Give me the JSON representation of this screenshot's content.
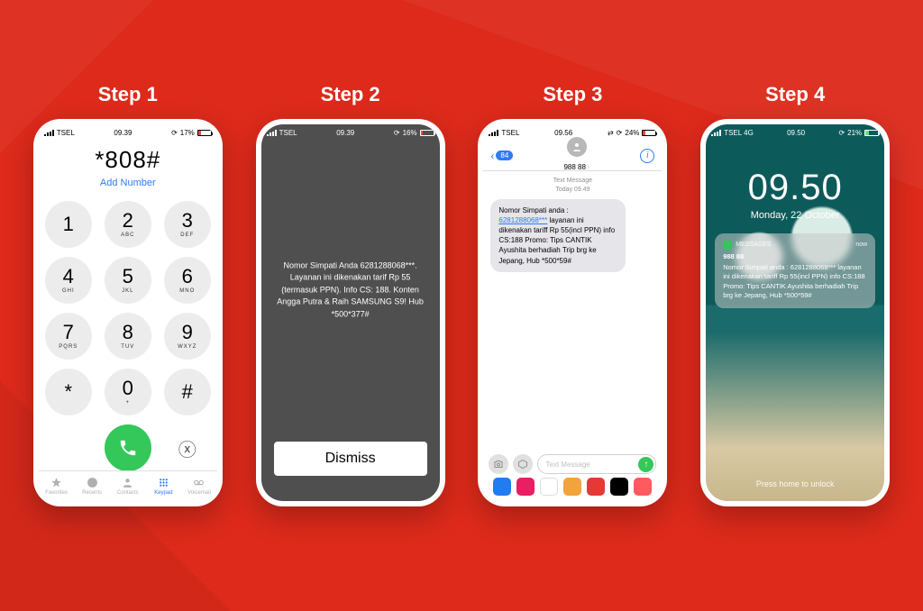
{
  "steps": [
    "Step 1",
    "Step 2",
    "Step 3",
    "Step 4"
  ],
  "p1": {
    "status": {
      "carrier": "TSEL",
      "time": "09.39",
      "batt": "17%"
    },
    "dial": "*808#",
    "add": "Add Number",
    "keys": [
      {
        "n": "1",
        "l": ""
      },
      {
        "n": "2",
        "l": "ABC"
      },
      {
        "n": "3",
        "l": "DEF"
      },
      {
        "n": "4",
        "l": "GHI"
      },
      {
        "n": "5",
        "l": "JKL"
      },
      {
        "n": "6",
        "l": "MNO"
      },
      {
        "n": "7",
        "l": "PQRS"
      },
      {
        "n": "8",
        "l": "TUV"
      },
      {
        "n": "9",
        "l": "WXYZ"
      },
      {
        "n": "*",
        "l": ""
      },
      {
        "n": "0",
        "l": "+"
      },
      {
        "n": "#",
        "l": ""
      }
    ],
    "tabs": [
      "Favorites",
      "Recents",
      "Contacts",
      "Keypad",
      "Voicemail"
    ]
  },
  "p2": {
    "status": {
      "carrier": "TSEL",
      "time": "09.39",
      "batt": "16%"
    },
    "msg": "Nomor Simpati Anda 6281288068***. Layanan ini dikenakan tarif Rp 55 (termasuk PPN). Info CS: 188. Konten Angga Putra & Raih SAMSUNG S9! Hub *500*377#",
    "dismiss": "Dismiss"
  },
  "p3": {
    "status": {
      "carrier": "TSEL",
      "time": "09.56",
      "batt": "24%"
    },
    "back_badge": "84",
    "contact": "988 88",
    "meta_line1": "Text Message",
    "meta_line2": "Today 09.49",
    "bubble_pre": "Nomor Simpati anda : ",
    "bubble_link": "6281288068***",
    "bubble_post": " layanan ini dikenakan tariff Rp 55(incl PPN) info CS:188 Promo: Tips CANTIK Ayushita berhadiah Trip brg ke Jepang, Hub *500*59#",
    "placeholder": "Text Message",
    "dock_colors": [
      "#1f7cf1",
      "#e91e63",
      "#fff",
      "#f2a33c",
      "#e53935",
      "#000",
      "#ff5a5f"
    ]
  },
  "p4": {
    "status": {
      "carrier": "TSEL  4G",
      "time": "09.50",
      "batt": "21%"
    },
    "time": "09.50",
    "date": "Monday, 22 October",
    "notif_app": "MESSAGES",
    "notif_when": "now",
    "notif_title": "988 88",
    "notif_body": "Nomor Simpati anda : 6281288068*** layanan ini dikenakan tariff Rp 55(incl PPN) info CS:188 Promo: Tips CANTIK Ayushita berhadiah Trip brg ke Jepang, Hub *500*59#",
    "unlock": "Press home to unlock"
  }
}
